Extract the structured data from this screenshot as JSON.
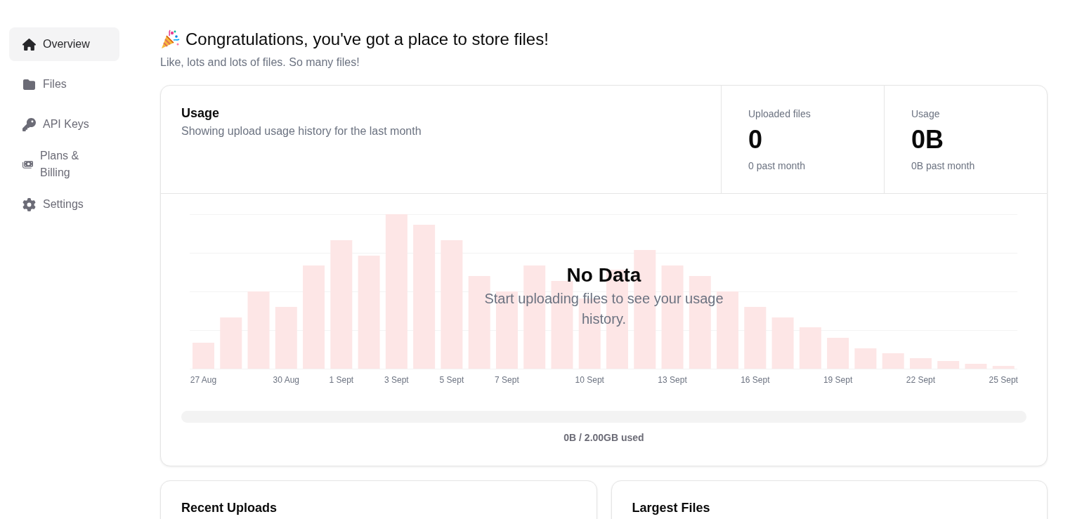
{
  "sidebar": {
    "items": [
      {
        "label": "Overview",
        "selected": true
      },
      {
        "label": "Files",
        "selected": false
      },
      {
        "label": "API Keys",
        "selected": false
      },
      {
        "label": "Plans & Billing",
        "selected": false
      },
      {
        "label": "Settings",
        "selected": false
      }
    ]
  },
  "header": {
    "title": "Congratulations, you've got a place to store files!",
    "subtitle": "Like, lots and lots of files. So many files!"
  },
  "usage_card": {
    "title": "Usage",
    "subtitle": "Showing upload usage history for the last month",
    "stats": [
      {
        "label": "Uploaded files",
        "value": "0",
        "note": "0 past month"
      },
      {
        "label": "Usage",
        "value": "0B",
        "note": "0B past month"
      }
    ],
    "chart": {
      "x_labels": [
        "27 Aug",
        "30 Aug",
        "1 Sept",
        "3 Sept",
        "5 Sept",
        "7 Sept",
        "10 Sept",
        "13 Sept",
        "16 Sept",
        "19 Sept",
        "22 Sept",
        "25 Sept"
      ],
      "empty_title": "No Data",
      "empty_message": "Start uploading files to see your usage history."
    },
    "storage": {
      "level": 0,
      "caption": "0B / 2.00GB used"
    }
  },
  "cards": [
    {
      "title": "Recent Uploads"
    },
    {
      "title": "Largest Files"
    }
  ]
}
